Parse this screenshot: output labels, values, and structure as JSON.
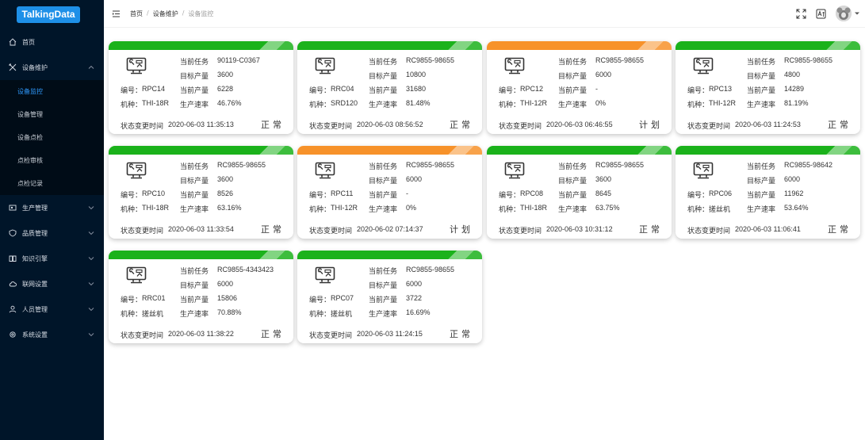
{
  "app": {
    "logo": "TalkingData"
  },
  "sidebar": {
    "items": [
      {
        "label": "首页",
        "icon": "home-icon"
      },
      {
        "label": "设备维护",
        "icon": "tools-icon",
        "expanded": true,
        "children": [
          {
            "label": "设备监控",
            "active": true
          },
          {
            "label": "设备管理"
          },
          {
            "label": "设备点检"
          },
          {
            "label": "点检审核"
          },
          {
            "label": "点检记录"
          }
        ]
      },
      {
        "label": "生产管理",
        "icon": "production-icon"
      },
      {
        "label": "品质管理",
        "icon": "shield-icon"
      },
      {
        "label": "知识引擎",
        "icon": "book-icon"
      },
      {
        "label": "联网设置",
        "icon": "cloud-icon"
      },
      {
        "label": "人员管理",
        "icon": "user-icon"
      },
      {
        "label": "系统设置",
        "icon": "gear-icon"
      }
    ]
  },
  "header": {
    "breadcrumb": [
      "首页",
      "设备维护",
      "设备监控"
    ],
    "icons": [
      "menu-fold-icon",
      "fullscreen-icon",
      "language-icon",
      "avatar"
    ]
  },
  "labels": {
    "task": "当前任务",
    "target": "目标产量",
    "current": "当前产量",
    "rate": "生产速率",
    "code": "编号：",
    "type": "机种：",
    "time_prefix": "状态变更时间"
  },
  "colors": {
    "normal": "#1bb21b",
    "plan": "#f7922a",
    "sidebar": "#001529",
    "accent": "#2f9bff"
  },
  "devices": [
    {
      "code": "RPC14",
      "type": "THI-18R",
      "task": "90119-C0367",
      "target": "3600",
      "current": "6228",
      "rate": "46.76%",
      "time": "2020-06-03 11:35:13",
      "status": "正常",
      "bar": "green"
    },
    {
      "code": "RRC04",
      "type": "SRD120",
      "task": "RC9855-98655",
      "target": "10800",
      "current": "31680",
      "rate": "81.48%",
      "time": "2020-06-03 08:56:52",
      "status": "正常",
      "bar": "green"
    },
    {
      "code": "RPC12",
      "type": "THI-12R",
      "task": "RC9855-98655",
      "target": "6000",
      "current": "-",
      "rate": "0%",
      "time": "2020-06-03 06:46:55",
      "status": "计划",
      "bar": "orange"
    },
    {
      "code": "RPC13",
      "type": "THI-12R",
      "task": "RC9855-98655",
      "target": "4800",
      "current": "14289",
      "rate": "81.19%",
      "time": "2020-06-03 11:24:53",
      "status": "正常",
      "bar": "green"
    },
    {
      "code": "RPC10",
      "type": "THI-18R",
      "task": "RC9855-98655",
      "target": "3600",
      "current": "8526",
      "rate": "63.16%",
      "time": "2020-06-03 11:33:54",
      "status": "正常",
      "bar": "green"
    },
    {
      "code": "RPC11",
      "type": "THI-12R",
      "task": "RC9855-98655",
      "target": "6000",
      "current": "-",
      "rate": "0%",
      "time": "2020-06-02 07:14:37",
      "status": "计划",
      "bar": "orange"
    },
    {
      "code": "RPC08",
      "type": "THI-18R",
      "task": "RC9855-98655",
      "target": "3600",
      "current": "8645",
      "rate": "63.75%",
      "time": "2020-06-03 10:31:12",
      "status": "正常",
      "bar": "green"
    },
    {
      "code": "RPC06",
      "type": "搓丝机",
      "task": "RC9855-98642",
      "target": "6000",
      "current": "11962",
      "rate": "53.64%",
      "time": "2020-06-03 11:06:41",
      "status": "正常",
      "bar": "green"
    },
    {
      "code": "RRC01",
      "type": "搓丝机",
      "task": "RC9855-4343423",
      "target": "6000",
      "current": "15806",
      "rate": "70.88%",
      "time": "2020-06-03 11:38:22",
      "status": "正常",
      "bar": "green"
    },
    {
      "code": "RPC07",
      "type": "搓丝机",
      "task": "RC9855-98655",
      "target": "6000",
      "current": "3722",
      "rate": "16.69%",
      "time": "2020-06-03 11:24:15",
      "status": "正常",
      "bar": "green"
    }
  ]
}
